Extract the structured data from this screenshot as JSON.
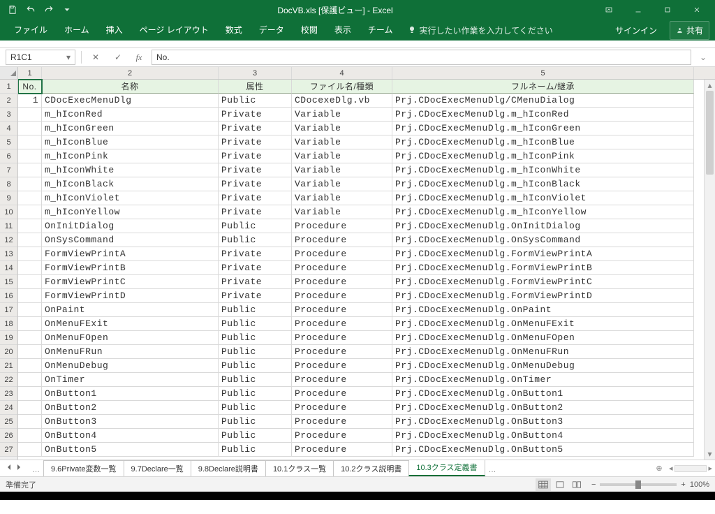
{
  "title": "DocVB.xls  [保護ビュー] - Excel",
  "ribbon": {
    "tabs": [
      "ファイル",
      "ホーム",
      "挿入",
      "ページ レイアウト",
      "数式",
      "データ",
      "校閲",
      "表示",
      "チーム"
    ],
    "tell_placeholder": "実行したい作業を入力してください",
    "signin": "サインイン",
    "share": "共有"
  },
  "namebox": "R1C1",
  "formula": "No.",
  "columns": {
    "labels": [
      "1",
      "2",
      "3",
      "4",
      "5"
    ],
    "widths": [
      34,
      253,
      105,
      144,
      432
    ]
  },
  "headers": [
    "No.",
    "名称",
    "属性",
    "ファイル名/種類",
    "フルネーム/継承"
  ],
  "rows": [
    {
      "no": "1",
      "name": "CDocExecMenuDlg",
      "attr": "Public",
      "file": "CDocexeDlg.vb",
      "full": "Prj.CDocExecMenuDlg/CMenuDialog"
    },
    {
      "no": "",
      "name": "m_hIconRed",
      "attr": "Private",
      "file": "Variable",
      "full": "Prj.CDocExecMenuDlg.m_hIconRed"
    },
    {
      "no": "",
      "name": "m_hIconGreen",
      "attr": "Private",
      "file": "Variable",
      "full": "Prj.CDocExecMenuDlg.m_hIconGreen"
    },
    {
      "no": "",
      "name": "m_hIconBlue",
      "attr": "Private",
      "file": "Variable",
      "full": "Prj.CDocExecMenuDlg.m_hIconBlue"
    },
    {
      "no": "",
      "name": "m_hIconPink",
      "attr": "Private",
      "file": "Variable",
      "full": "Prj.CDocExecMenuDlg.m_hIconPink"
    },
    {
      "no": "",
      "name": "m_hIconWhite",
      "attr": "Private",
      "file": "Variable",
      "full": "Prj.CDocExecMenuDlg.m_hIconWhite"
    },
    {
      "no": "",
      "name": "m_hIconBlack",
      "attr": "Private",
      "file": "Variable",
      "full": "Prj.CDocExecMenuDlg.m_hIconBlack"
    },
    {
      "no": "",
      "name": "m_hIconViolet",
      "attr": "Private",
      "file": "Variable",
      "full": "Prj.CDocExecMenuDlg.m_hIconViolet"
    },
    {
      "no": "",
      "name": "m_hIconYellow",
      "attr": "Private",
      "file": "Variable",
      "full": "Prj.CDocExecMenuDlg.m_hIconYellow"
    },
    {
      "no": "",
      "name": "OnInitDialog",
      "attr": "Public",
      "file": "Procedure",
      "full": "Prj.CDocExecMenuDlg.OnInitDialog"
    },
    {
      "no": "",
      "name": "OnSysCommand",
      "attr": "Public",
      "file": "Procedure",
      "full": "Prj.CDocExecMenuDlg.OnSysCommand"
    },
    {
      "no": "",
      "name": "FormViewPrintA",
      "attr": "Private",
      "file": "Procedure",
      "full": "Prj.CDocExecMenuDlg.FormViewPrintA"
    },
    {
      "no": "",
      "name": "FormViewPrintB",
      "attr": "Private",
      "file": "Procedure",
      "full": "Prj.CDocExecMenuDlg.FormViewPrintB"
    },
    {
      "no": "",
      "name": "FormViewPrintC",
      "attr": "Private",
      "file": "Procedure",
      "full": "Prj.CDocExecMenuDlg.FormViewPrintC"
    },
    {
      "no": "",
      "name": "FormViewPrintD",
      "attr": "Private",
      "file": "Procedure",
      "full": "Prj.CDocExecMenuDlg.FormViewPrintD"
    },
    {
      "no": "",
      "name": "OnPaint",
      "attr": "Public",
      "file": "Procedure",
      "full": "Prj.CDocExecMenuDlg.OnPaint"
    },
    {
      "no": "",
      "name": "OnMenuFExit",
      "attr": "Public",
      "file": "Procedure",
      "full": "Prj.CDocExecMenuDlg.OnMenuFExit"
    },
    {
      "no": "",
      "name": "OnMenuFOpen",
      "attr": "Public",
      "file": "Procedure",
      "full": "Prj.CDocExecMenuDlg.OnMenuFOpen"
    },
    {
      "no": "",
      "name": "OnMenuFRun",
      "attr": "Public",
      "file": "Procedure",
      "full": "Prj.CDocExecMenuDlg.OnMenuFRun"
    },
    {
      "no": "",
      "name": "OnMenuDebug",
      "attr": "Public",
      "file": "Procedure",
      "full": "Prj.CDocExecMenuDlg.OnMenuDebug"
    },
    {
      "no": "",
      "name": "OnTimer",
      "attr": "Public",
      "file": "Procedure",
      "full": "Prj.CDocExecMenuDlg.OnTimer"
    },
    {
      "no": "",
      "name": "OnButton1",
      "attr": "Public",
      "file": "Procedure",
      "full": "Prj.CDocExecMenuDlg.OnButton1"
    },
    {
      "no": "",
      "name": "OnButton2",
      "attr": "Public",
      "file": "Procedure",
      "full": "Prj.CDocExecMenuDlg.OnButton2"
    },
    {
      "no": "",
      "name": "OnButton3",
      "attr": "Public",
      "file": "Procedure",
      "full": "Prj.CDocExecMenuDlg.OnButton3"
    },
    {
      "no": "",
      "name": "OnButton4",
      "attr": "Public",
      "file": "Procedure",
      "full": "Prj.CDocExecMenuDlg.OnButton4"
    },
    {
      "no": "",
      "name": "OnButton5",
      "attr": "Public",
      "file": "Procedure",
      "full": "Prj.CDocExecMenuDlg.OnButton5"
    }
  ],
  "sheet_tabs": {
    "dots_left": "…",
    "items": [
      "9.6Private変数一覧",
      "9.7Declare一覧",
      "9.8Declare説明書",
      "10.1クラス一覧",
      "10.2クラス説明書",
      "10.3クラス定義書"
    ],
    "active_index": 5,
    "dots_right": "…"
  },
  "status": {
    "ready": "準備完了",
    "zoom": "100%"
  }
}
